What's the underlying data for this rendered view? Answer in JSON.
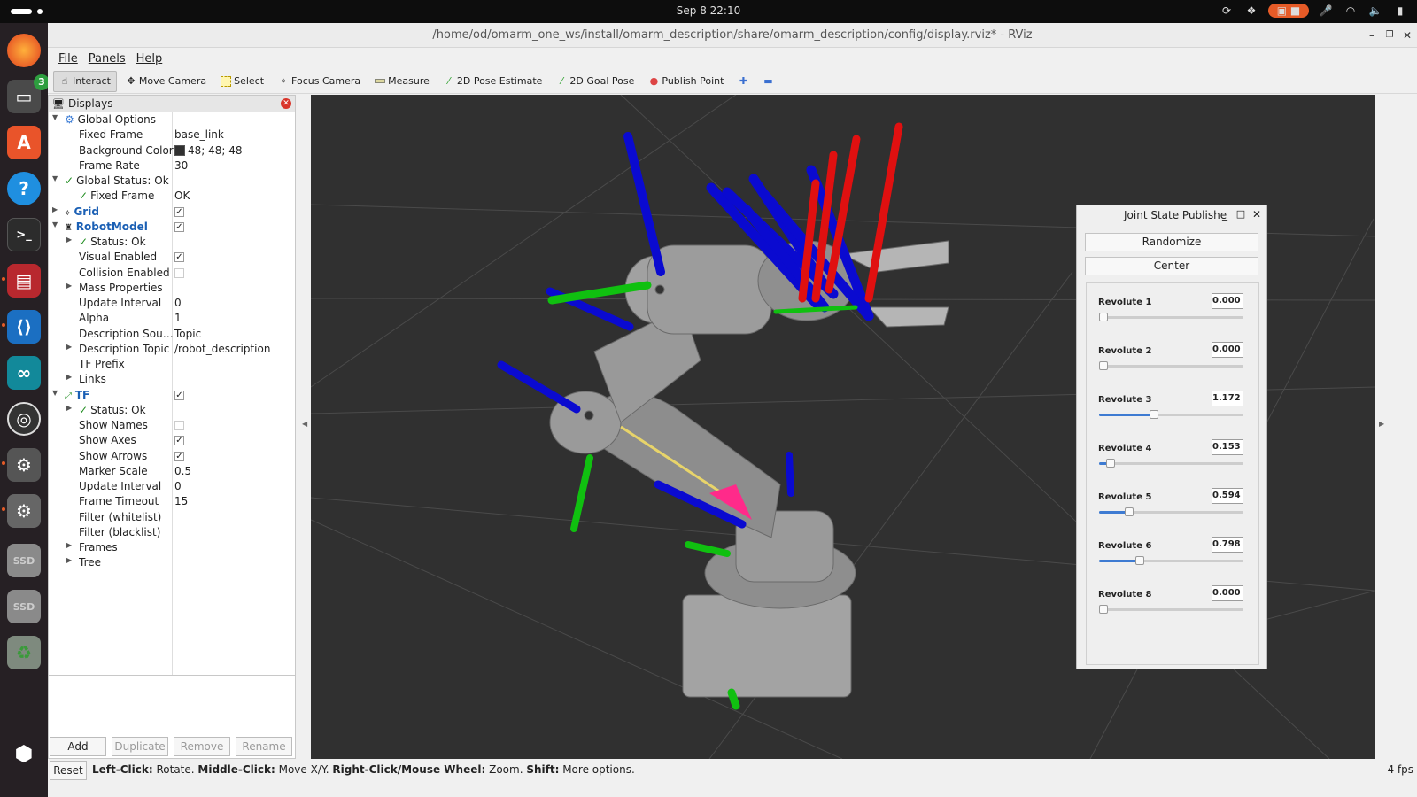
{
  "system": {
    "clock": "Sep 8  22:10"
  },
  "window": {
    "title": "/home/od/omarm_one_ws/install/omarm_description/share/omarm_description/config/display.rviz* - RViz"
  },
  "menu": [
    "File",
    "Panels",
    "Help"
  ],
  "toolbar": {
    "tools": [
      {
        "label": "Interact",
        "icon": "hand-icon"
      },
      {
        "label": "Move Camera",
        "icon": "move-icon"
      },
      {
        "label": "Select",
        "icon": "select-icon"
      },
      {
        "label": "Focus Camera",
        "icon": "focus-icon"
      },
      {
        "label": "Measure",
        "icon": "ruler-icon"
      },
      {
        "label": "2D Pose Estimate",
        "icon": "green-arrow-icon"
      },
      {
        "label": "2D Goal Pose",
        "icon": "green-arrow-icon"
      },
      {
        "label": "Publish Point",
        "icon": "pin-icon"
      }
    ]
  },
  "displays": {
    "title": "Displays",
    "rows": [
      {
        "label": "Global Options",
        "value": ""
      },
      {
        "label": "Fixed Frame",
        "value": "base_link"
      },
      {
        "label": "Background Color",
        "value": "48; 48; 48"
      },
      {
        "label": "Frame Rate",
        "value": "30"
      },
      {
        "label": "Global Status: Ok",
        "value": ""
      },
      {
        "label": "Fixed Frame",
        "value": "OK"
      },
      {
        "label": "Grid",
        "value": ""
      },
      {
        "label": "RobotModel",
        "value": ""
      },
      {
        "label": "Status: Ok",
        "value": ""
      },
      {
        "label": "Visual Enabled",
        "value": ""
      },
      {
        "label": "Collision Enabled",
        "value": ""
      },
      {
        "label": "Mass Properties",
        "value": ""
      },
      {
        "label": "Update Interval",
        "value": "0"
      },
      {
        "label": "Alpha",
        "value": "1"
      },
      {
        "label": "Description Sou…",
        "value": "Topic"
      },
      {
        "label": "Description Topic",
        "value": "/robot_description"
      },
      {
        "label": "TF Prefix",
        "value": ""
      },
      {
        "label": "Links",
        "value": ""
      },
      {
        "label": "TF",
        "value": ""
      },
      {
        "label": "Status: Ok",
        "value": ""
      },
      {
        "label": "Show Names",
        "value": ""
      },
      {
        "label": "Show Axes",
        "value": ""
      },
      {
        "label": "Show Arrows",
        "value": ""
      },
      {
        "label": "Marker Scale",
        "value": "0.5"
      },
      {
        "label": "Update Interval",
        "value": "0"
      },
      {
        "label": "Frame Timeout",
        "value": "15"
      },
      {
        "label": "Filter (whitelist)",
        "value": ""
      },
      {
        "label": "Filter (blacklist)",
        "value": ""
      },
      {
        "label": "Frames",
        "value": ""
      },
      {
        "label": "Tree",
        "value": ""
      }
    ],
    "buttons": {
      "add": "Add",
      "duplicate": "Duplicate",
      "remove": "Remove",
      "rename": "Rename"
    }
  },
  "joint_state_publisher": {
    "title": "Joint State Publishe",
    "randomize": "Randomize",
    "center": "Center",
    "joints": [
      {
        "name": "Revolute 1",
        "value": "0.000",
        "fraction": 0.0
      },
      {
        "name": "Revolute 2",
        "value": "0.000",
        "fraction": 0.0
      },
      {
        "name": "Revolute 3",
        "value": "1.172",
        "fraction": 0.38
      },
      {
        "name": "Revolute 4",
        "value": "0.153",
        "fraction": 0.08
      },
      {
        "name": "Revolute 5",
        "value": "0.594",
        "fraction": 0.21
      },
      {
        "name": "Revolute 6",
        "value": "0.798",
        "fraction": 0.28
      },
      {
        "name": "Revolute 8",
        "value": "0.000",
        "fraction": 0.0
      }
    ]
  },
  "statusbar": {
    "reset": "Reset",
    "hint_lc": "Left-Click:",
    "hint_lc_t": " Rotate. ",
    "hint_mc": "Middle-Click:",
    "hint_mc_t": " Move X/Y. ",
    "hint_rc": "Right-Click/Mouse Wheel:",
    "hint_rc_t": " Zoom. ",
    "hint_sh": "Shift:",
    "hint_sh_t": " More options.",
    "fps": "4 fps"
  },
  "colors": {
    "viewport_bg": "#303030",
    "axis_x": "#e01010",
    "axis_y": "#10c010",
    "axis_z": "#0a0ad0",
    "robot": "#9a9a9a",
    "accent": "#e65b27"
  }
}
